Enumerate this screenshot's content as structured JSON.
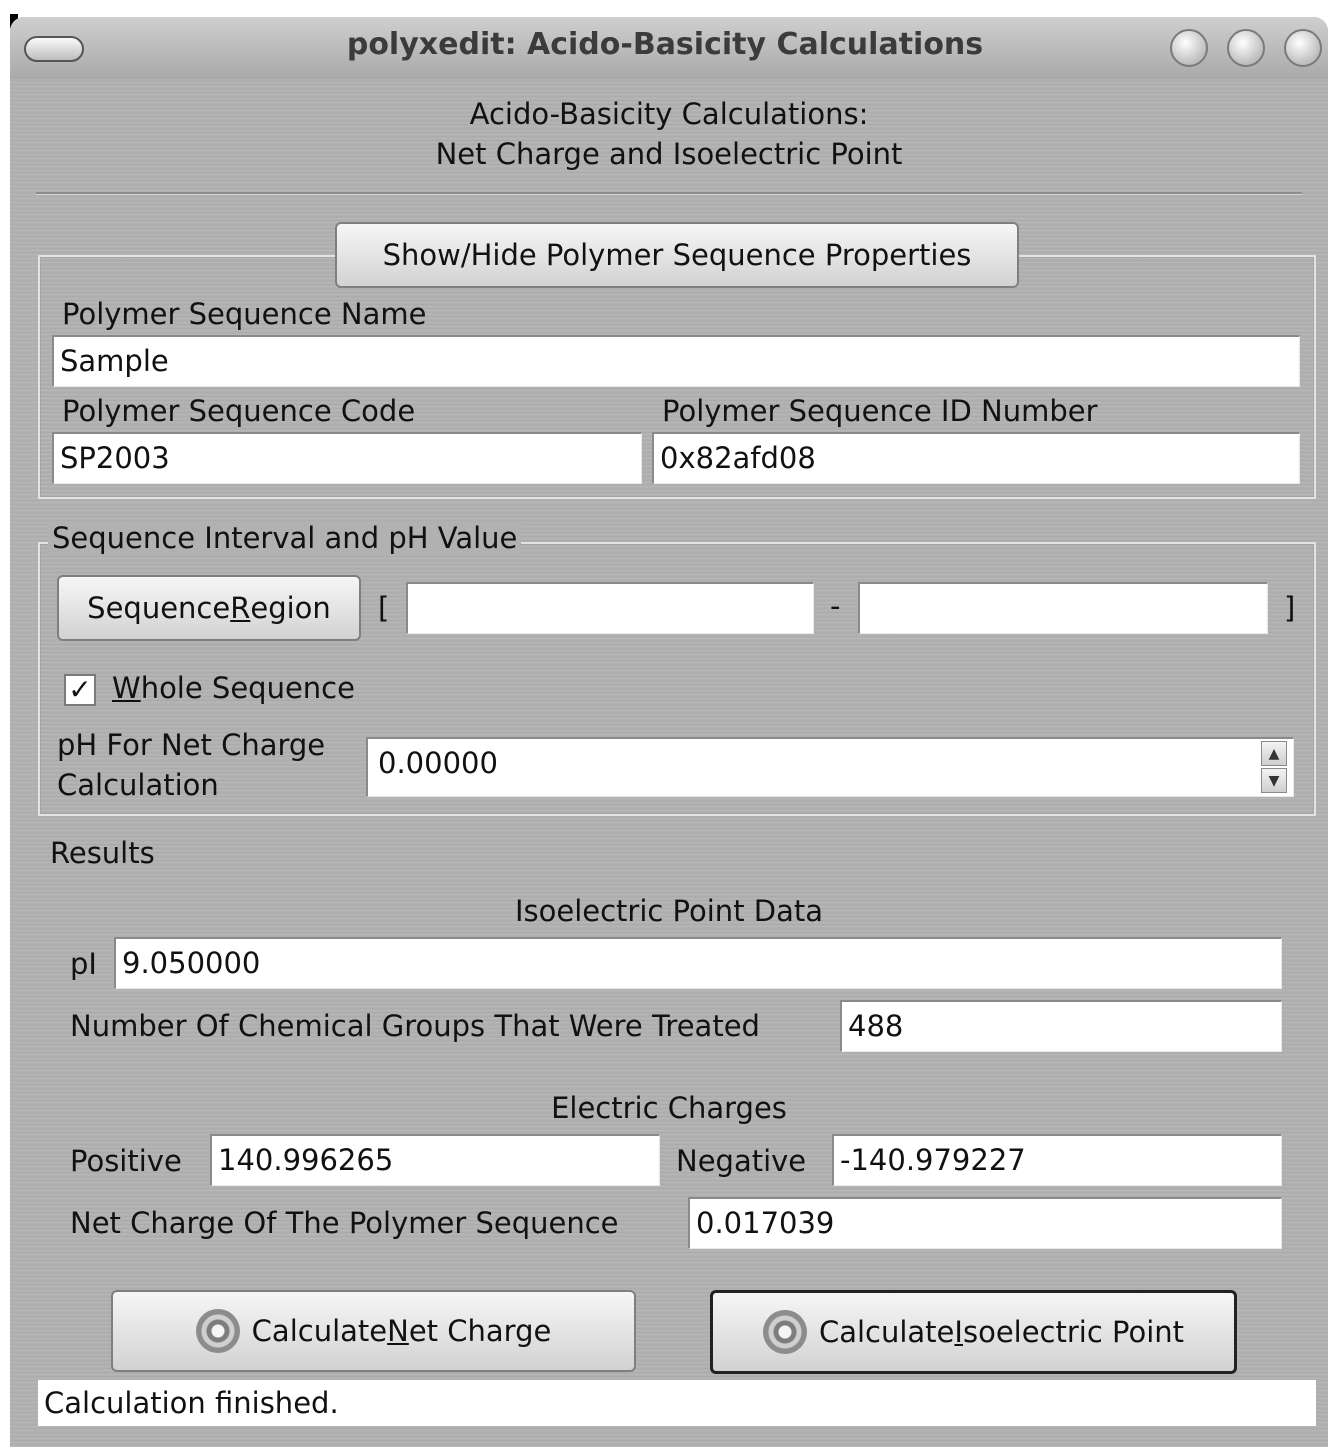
{
  "window": {
    "title": "polyxedit: Acido-Basicity Calculations"
  },
  "heading": {
    "line1": "Acido-Basicity Calculations:",
    "line2": "Net Charge and Isoelectric Point"
  },
  "properties": {
    "toggle_button": "Show/Hide Polymer Sequence Properties",
    "name_label": "Polymer Sequence Name",
    "name_value": "Sample",
    "code_label": "Polymer Sequence Code",
    "code_value": "SP2003",
    "id_label": "Polymer Sequence ID Number",
    "id_value": "0x82afd08"
  },
  "interval": {
    "legend": "Sequence Interval and pH Value",
    "region_button_pre": "Sequence ",
    "region_button_mnemonic": "R",
    "region_button_post": "egion",
    "bracket_open": "[",
    "dash": "-",
    "bracket_close": "]",
    "start_value": "",
    "end_value": "",
    "whole_sequence_mnemonic": "W",
    "whole_sequence_rest": "hole Sequence",
    "whole_sequence_checked": true,
    "check_mark": "✓",
    "ph_label_line1": "pH For Net Charge",
    "ph_label_line2": "Calculation",
    "ph_value": "0.00000",
    "spin_up": "▲",
    "spin_down": "▼"
  },
  "results": {
    "title": "Results",
    "isoelectric_heading": "Isoelectric Point Data",
    "pi_label": "pI",
    "pi_value": "9.050000",
    "groups_label": "Number Of Chemical Groups That Were Treated",
    "groups_value": "488",
    "charges_heading": "Electric Charges",
    "positive_label": "Positive",
    "positive_value": "140.996265",
    "negative_label": "Negative",
    "negative_value": "-140.979227",
    "net_label": "Net Charge Of The Polymer Sequence",
    "net_value": "0.017039"
  },
  "actions": {
    "net_charge_pre": "Calculate ",
    "net_charge_mnemonic": "N",
    "net_charge_post": "et Charge",
    "isoelectric_pre": "Calculate ",
    "isoelectric_mnemonic": "I",
    "isoelectric_post": "soelectric Point"
  },
  "status": {
    "text": "Calculation finished."
  },
  "icons": {
    "window_menu": "window-menu-icon",
    "minimize": "minimize-icon",
    "maximize": "maximize-icon",
    "close": "close-icon",
    "gear": "gear-icon"
  },
  "colors": {
    "window_bg": "#b1b1b1",
    "field_bg": "#ffffff"
  }
}
